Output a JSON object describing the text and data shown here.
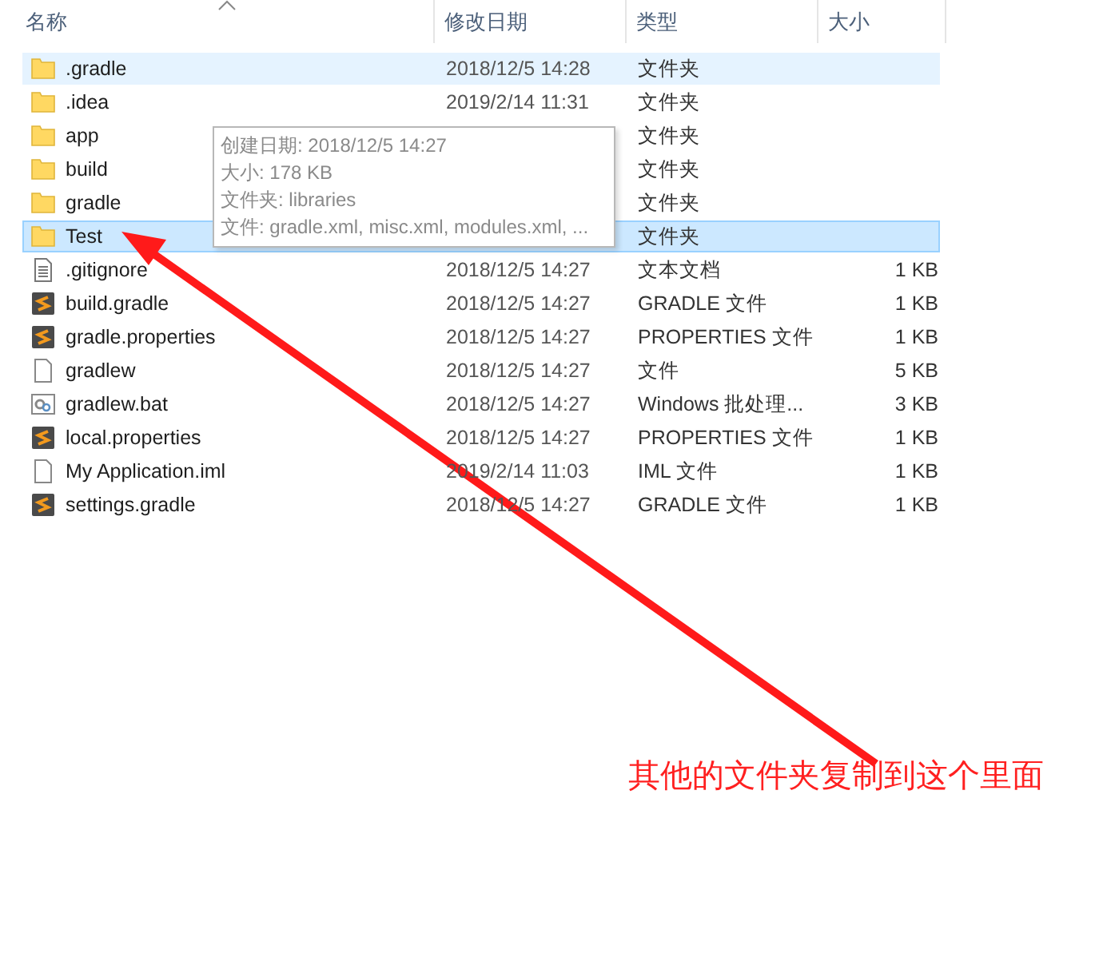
{
  "columns": [
    {
      "label": "名称"
    },
    {
      "label": "修改日期"
    },
    {
      "label": "类型"
    },
    {
      "label": "大小"
    }
  ],
  "files": [
    {
      "name": ".gradle",
      "kind": "folder",
      "date": "2018/12/5 14:28",
      "type": "文件夹",
      "hovered": true,
      "selected": false
    },
    {
      "name": ".idea",
      "kind": "folder",
      "date": "2019/2/14 11:31",
      "type": "文件夹",
      "hovered": false,
      "selected": false
    },
    {
      "name": "app",
      "kind": "folder",
      "type": "文件夹",
      "hovered": false,
      "selected": false
    },
    {
      "name": "build",
      "kind": "folder",
      "type": "文件夹",
      "hovered": false,
      "selected": false
    },
    {
      "name": "gradle",
      "kind": "folder",
      "type": "文件夹",
      "hovered": false,
      "selected": false
    },
    {
      "name": "Test",
      "kind": "folder",
      "type": "文件夹",
      "hovered": false,
      "selected": true
    },
    {
      "name": ".gitignore",
      "kind": "text",
      "date": "2018/12/5 14:27",
      "type": "文本文档",
      "size": "1 KB",
      "hovered": false,
      "selected": false
    },
    {
      "name": "build.gradle",
      "kind": "editor",
      "date": "2018/12/5 14:27",
      "type": "GRADLE 文件",
      "size": "1 KB",
      "hovered": false,
      "selected": false
    },
    {
      "name": "gradle.properties",
      "kind": "editor",
      "date": "2018/12/5 14:27",
      "type": "PROPERTIES 文件",
      "size": "1 KB",
      "hovered": false,
      "selected": false
    },
    {
      "name": "gradlew",
      "kind": "blank",
      "date": "2018/12/5 14:27",
      "type": "文件",
      "size": "5 KB",
      "hovered": false,
      "selected": false
    },
    {
      "name": "gradlew.bat",
      "kind": "script",
      "date": "2018/12/5 14:27",
      "type": "Windows 批处理...",
      "size": "3 KB",
      "hovered": false,
      "selected": false
    },
    {
      "name": "local.properties",
      "kind": "editor",
      "date": "2018/12/5 14:27",
      "type": "PROPERTIES 文件",
      "size": "1 KB",
      "hovered": false,
      "selected": false
    },
    {
      "name": "My Application.iml",
      "kind": "blank",
      "date": "2019/2/14 11:03",
      "type": "IML 文件",
      "size": "1 KB",
      "hovered": false,
      "selected": false
    },
    {
      "name": "settings.gradle",
      "kind": "editor",
      "date": "2018/12/5 14:27",
      "type": "GRADLE 文件",
      "size": "1 KB",
      "hovered": false,
      "selected": false
    }
  ],
  "tooltip": {
    "lines": [
      "创建日期: 2018/12/5 14:27",
      "大小: 178 KB",
      "文件夹: libraries",
      "文件: gradle.xml, misc.xml, modules.xml, ..."
    ]
  },
  "annotation": {
    "text": "其他的文件夹复制到这个里面"
  }
}
